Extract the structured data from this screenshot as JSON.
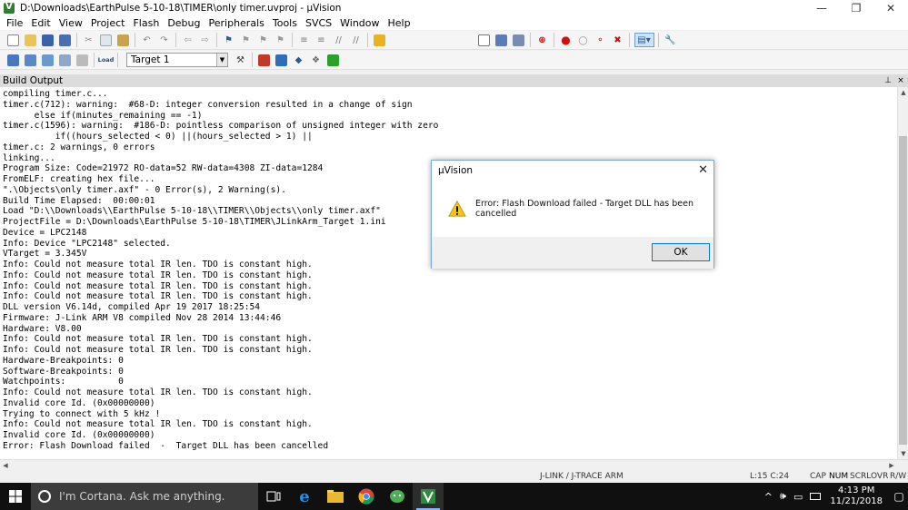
{
  "window": {
    "title": "D:\\Downloads\\EarthPulse 5-10-18\\TIMER\\only timer.uvproj - µVision",
    "minimize_glyph": "—",
    "maximize_glyph": "❐",
    "close_glyph": "✕"
  },
  "menu": [
    "File",
    "Edit",
    "View",
    "Project",
    "Flash",
    "Debug",
    "Peripherals",
    "Tools",
    "SVCS",
    "Window",
    "Help"
  ],
  "toolbar2": {
    "target_label": "Target 1",
    "load_icon_text": "Load"
  },
  "panel": {
    "title": "Build Output",
    "pin_glyph": "⊥",
    "close_glyph": "×"
  },
  "output_lines": [
    "compiling timer.c...",
    "timer.c(712): warning:  #68-D: integer conversion resulted in a change of sign",
    "      else if(minutes_remaining == -1)",
    "timer.c(1596): warning:  #186-D: pointless comparison of unsigned integer with zero",
    "          if((hours_selected < 0) ||(hours_selected > 1) ||",
    "timer.c: 2 warnings, 0 errors",
    "linking...",
    "Program Size: Code=21972 RO-data=52 RW-data=4308 ZI-data=1284",
    "FromELF: creating hex file...",
    "\".\\Objects\\only timer.axf\" - 0 Error(s), 2 Warning(s).",
    "Build Time Elapsed:  00:00:01",
    "Load \"D:\\\\Downloads\\\\EarthPulse 5-10-18\\\\TIMER\\\\Objects\\\\only timer.axf\"",
    "ProjectFile = D:\\Downloads\\EarthPulse 5-10-18\\TIMER\\JLinkArm_Target 1.ini",
    "Device = LPC2148",
    "Info: Device \"LPC2148\" selected.",
    "VTarget = 3.345V",
    "Info: Could not measure total IR len. TDO is constant high.",
    "Info: Could not measure total IR len. TDO is constant high.",
    "Info: Could not measure total IR len. TDO is constant high.",
    "Info: Could not measure total IR len. TDO is constant high.",
    "DLL version V6.14d, compiled Apr 19 2017 18:25:54",
    "Firmware: J-Link ARM V8 compiled Nov 28 2014 13:44:46",
    "Hardware: V8.00",
    "Info: Could not measure total IR len. TDO is constant high.",
    "Info: Could not measure total IR len. TDO is constant high.",
    "Hardware-Breakpoints: 0",
    "Software-Breakpoints: 0",
    "Watchpoints:          0",
    "Info: Could not measure total IR len. TDO is constant high.",
    "Invalid core Id. (0x00000000)",
    "Trying to connect with 5 kHz !",
    "Info: Could not measure total IR len. TDO is constant high.",
    "Invalid core Id. (0x00000000)",
    "Error: Flash Download failed  -  Target DLL has been cancelled"
  ],
  "statusbar": {
    "debugger": "J-LINK / J-TRACE ARM",
    "position": "L:15 C:24",
    "cap": "CAP",
    "num": "NUM",
    "scrl": "SCRL",
    "ovr": "OVR",
    "rw": "R/W"
  },
  "dialog": {
    "title": "µVision",
    "message": "Error: Flash Download failed  -  Target DLL has been cancelled",
    "ok_label": "OK",
    "close_glyph": "✕"
  },
  "taskbar": {
    "search_placeholder": "I'm Cortana. Ask me anything.",
    "time": "4:13 PM",
    "date": "11/21/2018",
    "tray_chevron": "^",
    "volume_glyph": "🕪",
    "network_glyph": "▭"
  },
  "colors": {
    "accent": "#0078d7",
    "warning_yellow": "#f5c518",
    "taskbar_bg": "#101010"
  }
}
